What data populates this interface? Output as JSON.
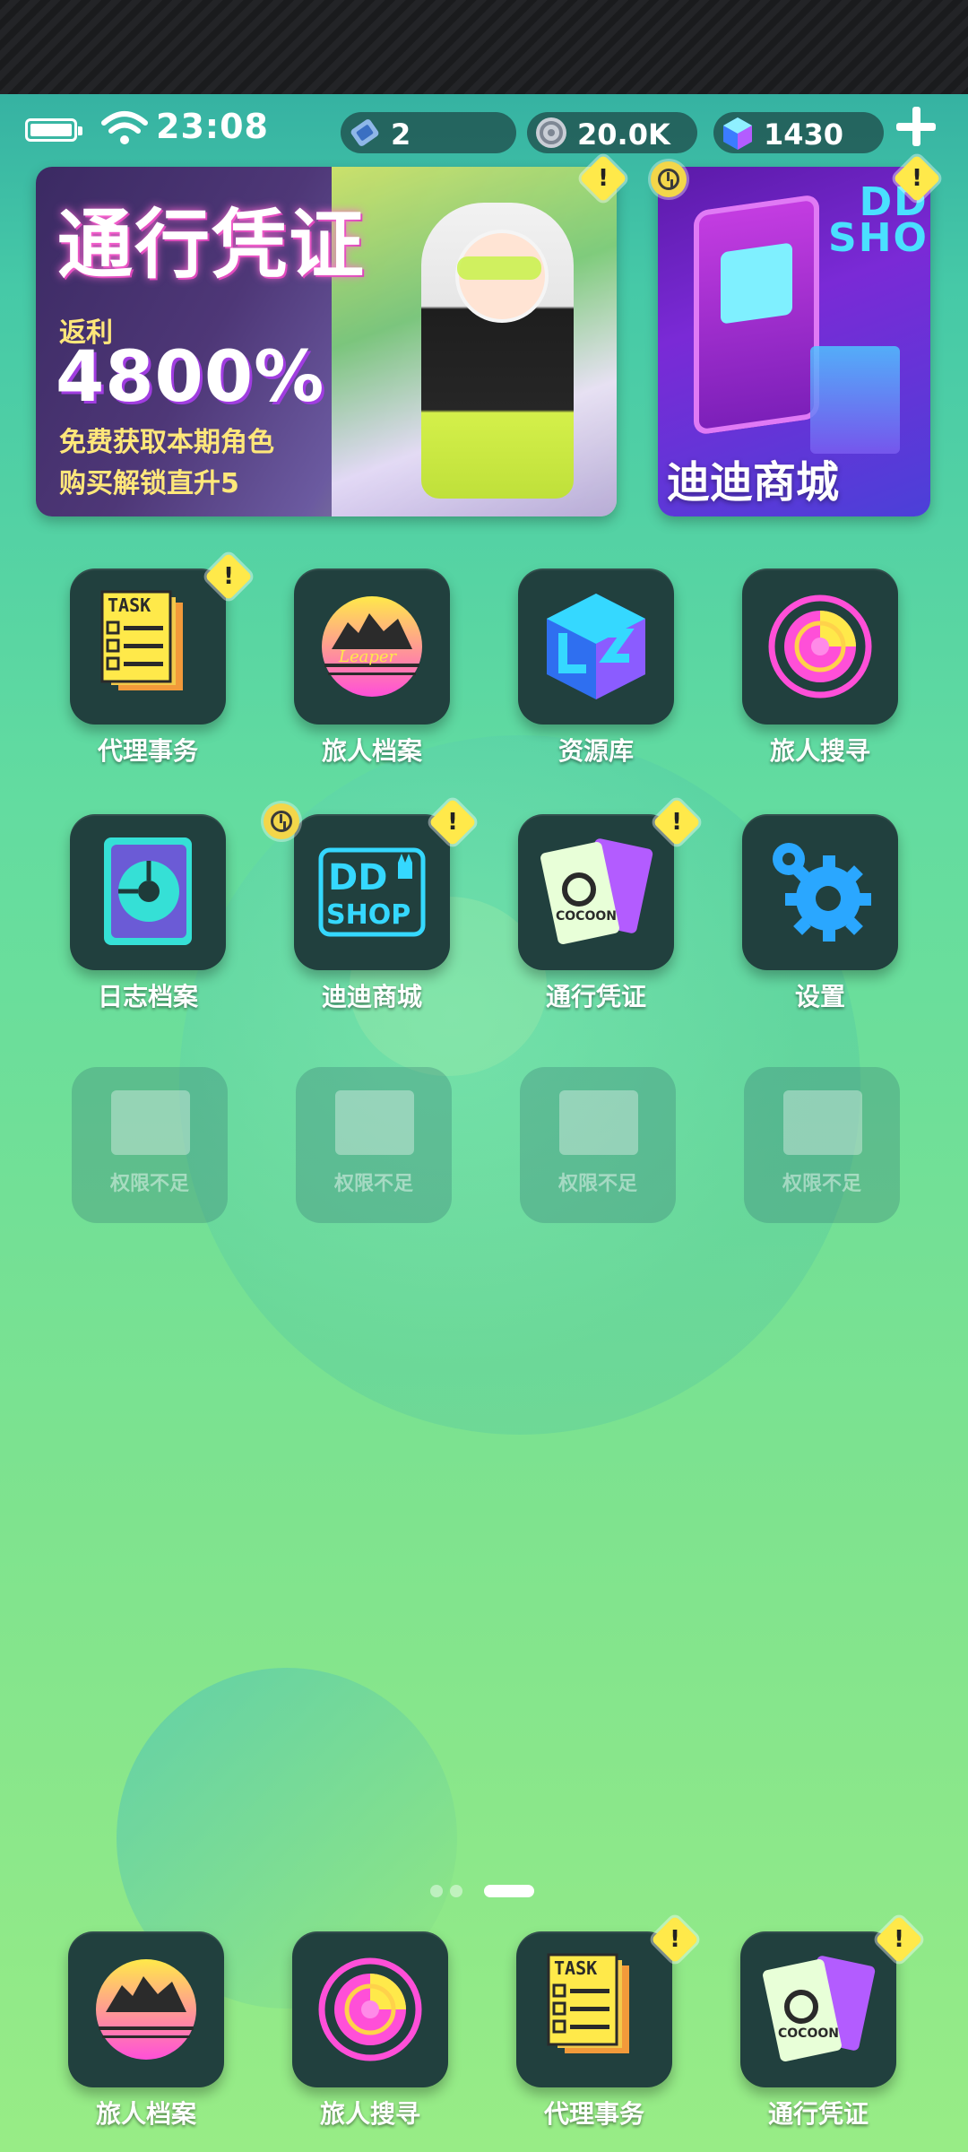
{
  "status": {
    "time": "23:08",
    "tickets": "2",
    "coins": "20.0K",
    "gems": "1430"
  },
  "banners": {
    "pass": {
      "title": "通行凭证",
      "rebate_label": "返利",
      "rebate_value": "4800%",
      "line1": "免费获取本期角色",
      "line2": "购买解锁直升5"
    },
    "shop": {
      "logo_line1": "DD",
      "logo_line2": "SHOP",
      "title": "迪迪商城"
    }
  },
  "apps": [
    {
      "label": "代理事务",
      "icon": "task-icon"
    },
    {
      "label": "旅人档案",
      "icon": "leaper-archives-icon"
    },
    {
      "label": "资源库",
      "icon": "resource-cube-icon"
    },
    {
      "label": "旅人搜寻",
      "icon": "radar-icon"
    },
    {
      "label": "日志档案",
      "icon": "disk-icon"
    },
    {
      "label": "迪迪商城",
      "icon": "dd-shop-icon"
    },
    {
      "label": "通行凭证",
      "icon": "cocoon-pass-icon"
    },
    {
      "label": "设置",
      "icon": "gear-icon"
    }
  ],
  "locked": {
    "label": "权限不足"
  },
  "dock": [
    {
      "label": "旅人档案"
    },
    {
      "label": "旅人搜寻"
    },
    {
      "label": "代理事务"
    },
    {
      "label": "通行凭证"
    }
  ],
  "badge": {
    "warn": "!"
  },
  "colors": {
    "tile": "#21403e",
    "warn": "#ffe94a",
    "accent_pink": "#ff4fd8",
    "accent_cyan": "#35d8ff"
  }
}
